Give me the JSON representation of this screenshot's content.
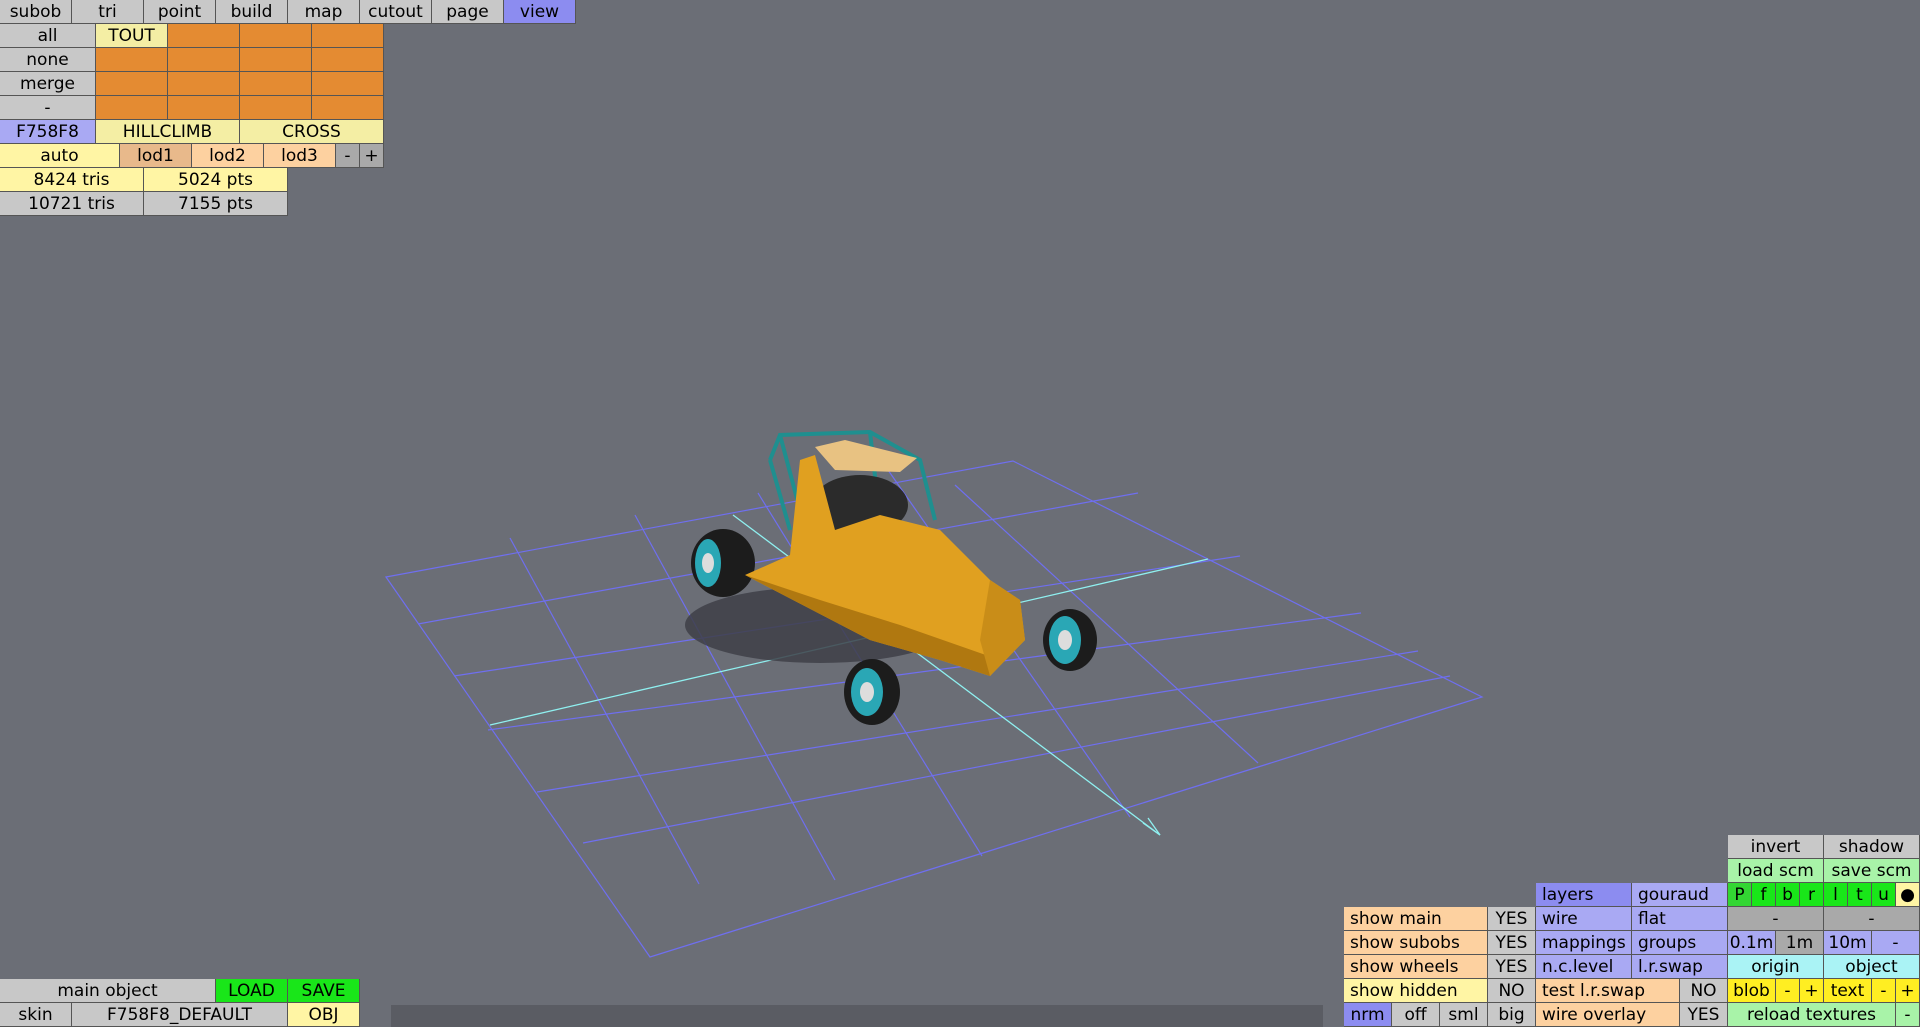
{
  "menu": {
    "tabs": [
      "subob",
      "tri",
      "point",
      "build",
      "map",
      "cutout",
      "page",
      "view"
    ],
    "active": "view"
  },
  "subob_panel": {
    "all": "all",
    "tout": "TOUT",
    "none": "none",
    "merge": "merge",
    "dash": "-",
    "color_code": "F758F8",
    "hillclimb": "HILLCLIMB",
    "cross": "CROSS",
    "auto": "auto",
    "lod1": "lod1",
    "lod2": "lod2",
    "lod3": "lod3",
    "minus": "-",
    "plus": "+",
    "tris1": "8424 tris",
    "pts1": "5024 pts",
    "tris2": "10721 tris",
    "pts2": "7155 pts"
  },
  "bottom_left": {
    "main_object": "main object",
    "load": "LOAD",
    "save": "SAVE",
    "skin": "skin",
    "skin_name": "F758F8_DEFAULT",
    "obj": "OBJ"
  },
  "show_panel": {
    "rows": [
      {
        "label": "show main",
        "value": "YES"
      },
      {
        "label": "show subobs",
        "value": "YES"
      },
      {
        "label": "show wheels",
        "value": "YES"
      },
      {
        "label": "show hidden",
        "value": "NO"
      }
    ],
    "sizes": [
      "nrm",
      "off",
      "sml",
      "big"
    ]
  },
  "render_panel": {
    "layers": "layers",
    "gouraud": "gouraud",
    "wire": "wire",
    "flat": "flat",
    "mappings": "mappings",
    "groups": "groups",
    "nclevel": "n.c.level",
    "lrswap": "l.r.swap",
    "test_lrswap": "test l.r.swap",
    "test_lrswap_value": "NO",
    "wire_overlay": "wire overlay",
    "wire_overlay_value": "YES"
  },
  "view_panel": {
    "invert": "invert",
    "shadow": "shadow",
    "load_scm": "load scm",
    "save_scm": "save scm",
    "views": [
      "P",
      "f",
      "b",
      "r",
      "l",
      "t",
      "u"
    ],
    "dot": "●",
    "dash1": "-",
    "dash2": "-",
    "grid": [
      "0.1m",
      "1m",
      "10m",
      "-"
    ],
    "origin": "origin",
    "object": "object",
    "blob": "blob",
    "blob_minus": "-",
    "blob_plus": "+",
    "text": "text",
    "text_minus": "-",
    "text_plus": "+",
    "reload_textures": "reload textures",
    "reload_minus": "-"
  },
  "colors": {
    "background": "#6b6e76",
    "car_body": "#e0a020",
    "roll_cage": "#1f8f8f",
    "grid_lines": "#6f6ff0",
    "axis_lines": "#8ff0f0"
  }
}
